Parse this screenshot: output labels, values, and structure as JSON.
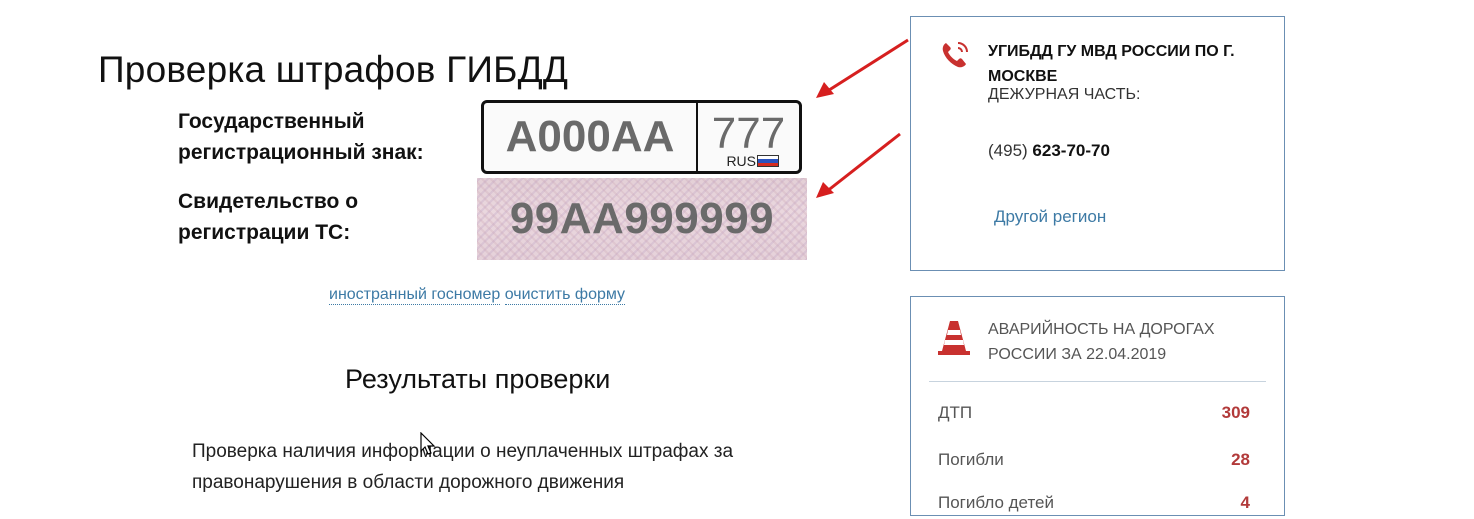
{
  "page": {
    "title": "Проверка штрафов ГИБДД"
  },
  "form": {
    "plate_label_line1": "Государственный",
    "plate_label_line2": "регистрационный знак:",
    "plate_number": "А000АА",
    "plate_region": "777",
    "plate_country": "RUS",
    "cert_label_line1": "Свидетельство о",
    "cert_label_line2": "регистрации ТС:",
    "cert_number": "99АА999999",
    "link_foreign": "иностранный госномер",
    "link_clear": "очистить форму"
  },
  "results": {
    "title": "Результаты проверки",
    "description": "Проверка наличия информации о неуплаченных штрафах за правонарушения в области дорожного движения"
  },
  "sidebar": {
    "contact": {
      "department": "УГИБДД ГУ МВД РОССИИ ПО Г. МОСКВЕ",
      "duty_label": "ДЕЖУРНАЯ ЧАСТЬ:",
      "phone_code": "(495)",
      "phone_number": "623-70-70",
      "other_region": "Другой регион"
    },
    "accidents": {
      "title": "АВАРИЙНОСТЬ НА ДОРОГАХ РОССИИ ЗА 22.04.2019",
      "stats": [
        {
          "label": "ДТП",
          "value": "309"
        },
        {
          "label": "Погибли",
          "value": "28"
        },
        {
          "label": "Погибло детей",
          "value": "4"
        }
      ]
    }
  },
  "colors": {
    "link": "#3d7aa5",
    "panel_border": "#6b8fb3",
    "stat_value": "#b23a3a",
    "arrow": "#d61f1f",
    "icon_red": "#c8312f"
  },
  "icons": {
    "phone": "phone-icon",
    "cone": "traffic-cone-icon",
    "cursor": "mouse-cursor-icon",
    "arrow": "red-arrow-icon"
  }
}
